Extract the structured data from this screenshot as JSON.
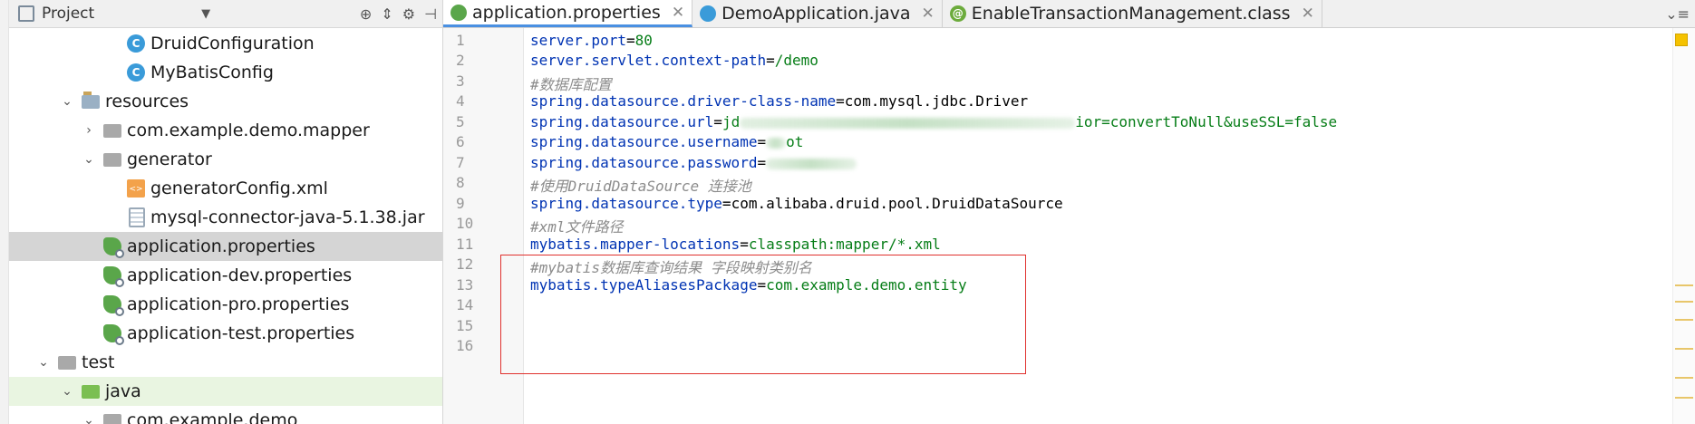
{
  "project_panel": {
    "title": "Project",
    "tree": [
      {
        "label": "DruidConfiguration",
        "icon": "class-icon",
        "depth": 3
      },
      {
        "label": "MyBatisConfig",
        "icon": "class-icon",
        "depth": 3
      },
      {
        "label": "resources",
        "icon": "resources-folder-icon",
        "depth": 1,
        "expanded": true
      },
      {
        "label": "com.example.demo.mapper",
        "icon": "folder-icon",
        "depth": 2,
        "expanded": false
      },
      {
        "label": "generator",
        "icon": "folder-icon",
        "depth": 2,
        "expanded": true
      },
      {
        "label": "generatorConfig.xml",
        "icon": "xml-file-icon",
        "depth": 3
      },
      {
        "label": "mysql-connector-java-5.1.38.jar",
        "icon": "jar-file-icon",
        "depth": 3
      },
      {
        "label": "application.properties",
        "icon": "spring-properties-icon",
        "depth": 2,
        "selected": true
      },
      {
        "label": "application-dev.properties",
        "icon": "spring-properties-icon",
        "depth": 2
      },
      {
        "label": "application-pro.properties",
        "icon": "spring-properties-icon",
        "depth": 2
      },
      {
        "label": "application-test.properties",
        "icon": "spring-properties-icon",
        "depth": 2
      },
      {
        "label": "test",
        "icon": "folder-icon",
        "depth": 0,
        "expanded": true
      },
      {
        "label": "java",
        "icon": "test-folder-icon",
        "depth": 1,
        "expanded": true
      },
      {
        "label": "com.example.demo",
        "icon": "folder-icon",
        "depth": 2,
        "expanded": true
      }
    ]
  },
  "tabs": [
    {
      "label": "application.properties",
      "icon": "spring-properties-icon",
      "active": true
    },
    {
      "label": "DemoApplication.java",
      "icon": "java-class-icon",
      "active": false
    },
    {
      "label": "EnableTransactionManagement.class",
      "icon": "annotation-icon",
      "active": false
    }
  ],
  "editor": {
    "line_numbers": [
      "1",
      "2",
      "3",
      "4",
      "5",
      "6",
      "7",
      "8",
      "9",
      "10",
      "11",
      "12",
      "13",
      "14",
      "15",
      "16"
    ],
    "lines": [
      {
        "key": "server.port",
        "val": "80"
      },
      {
        "key": "server.servlet.context-path",
        "val": "/demo"
      },
      {
        "comment": "#数据库配置"
      },
      {
        "key": "spring.datasource.driver-class-name",
        "val": "com.mysql.jdbc.Driver"
      },
      {
        "key": "spring.datasource.url",
        "val_start": "jd",
        "val_end": "ior=convertToNull&useSSL=false"
      },
      {
        "key": "spring.datasource.username",
        "val_end": "ot"
      },
      {
        "key": "spring.datasource.password"
      },
      {
        "comment": "#使用DruidDataSource 连接池"
      },
      {
        "key": "spring.datasource.type",
        "val": "com.alibaba.druid.pool.DruidDataSource"
      },
      {
        "comment": "#xml文件路径"
      },
      {
        "key": "mybatis.mapper-locations",
        "val": "classpath:mapper/*.xml"
      },
      {
        "comment": "#mybatis数据库查询结果 字段映射类别名"
      },
      {
        "key": "mybatis.typeAliasesPackage",
        "val": "com.example.demo.entity"
      }
    ]
  },
  "colors": {
    "key": "#0033b3",
    "value": "#067d17",
    "comment": "#8c8c8c",
    "highlight_box": "#e0312e"
  }
}
